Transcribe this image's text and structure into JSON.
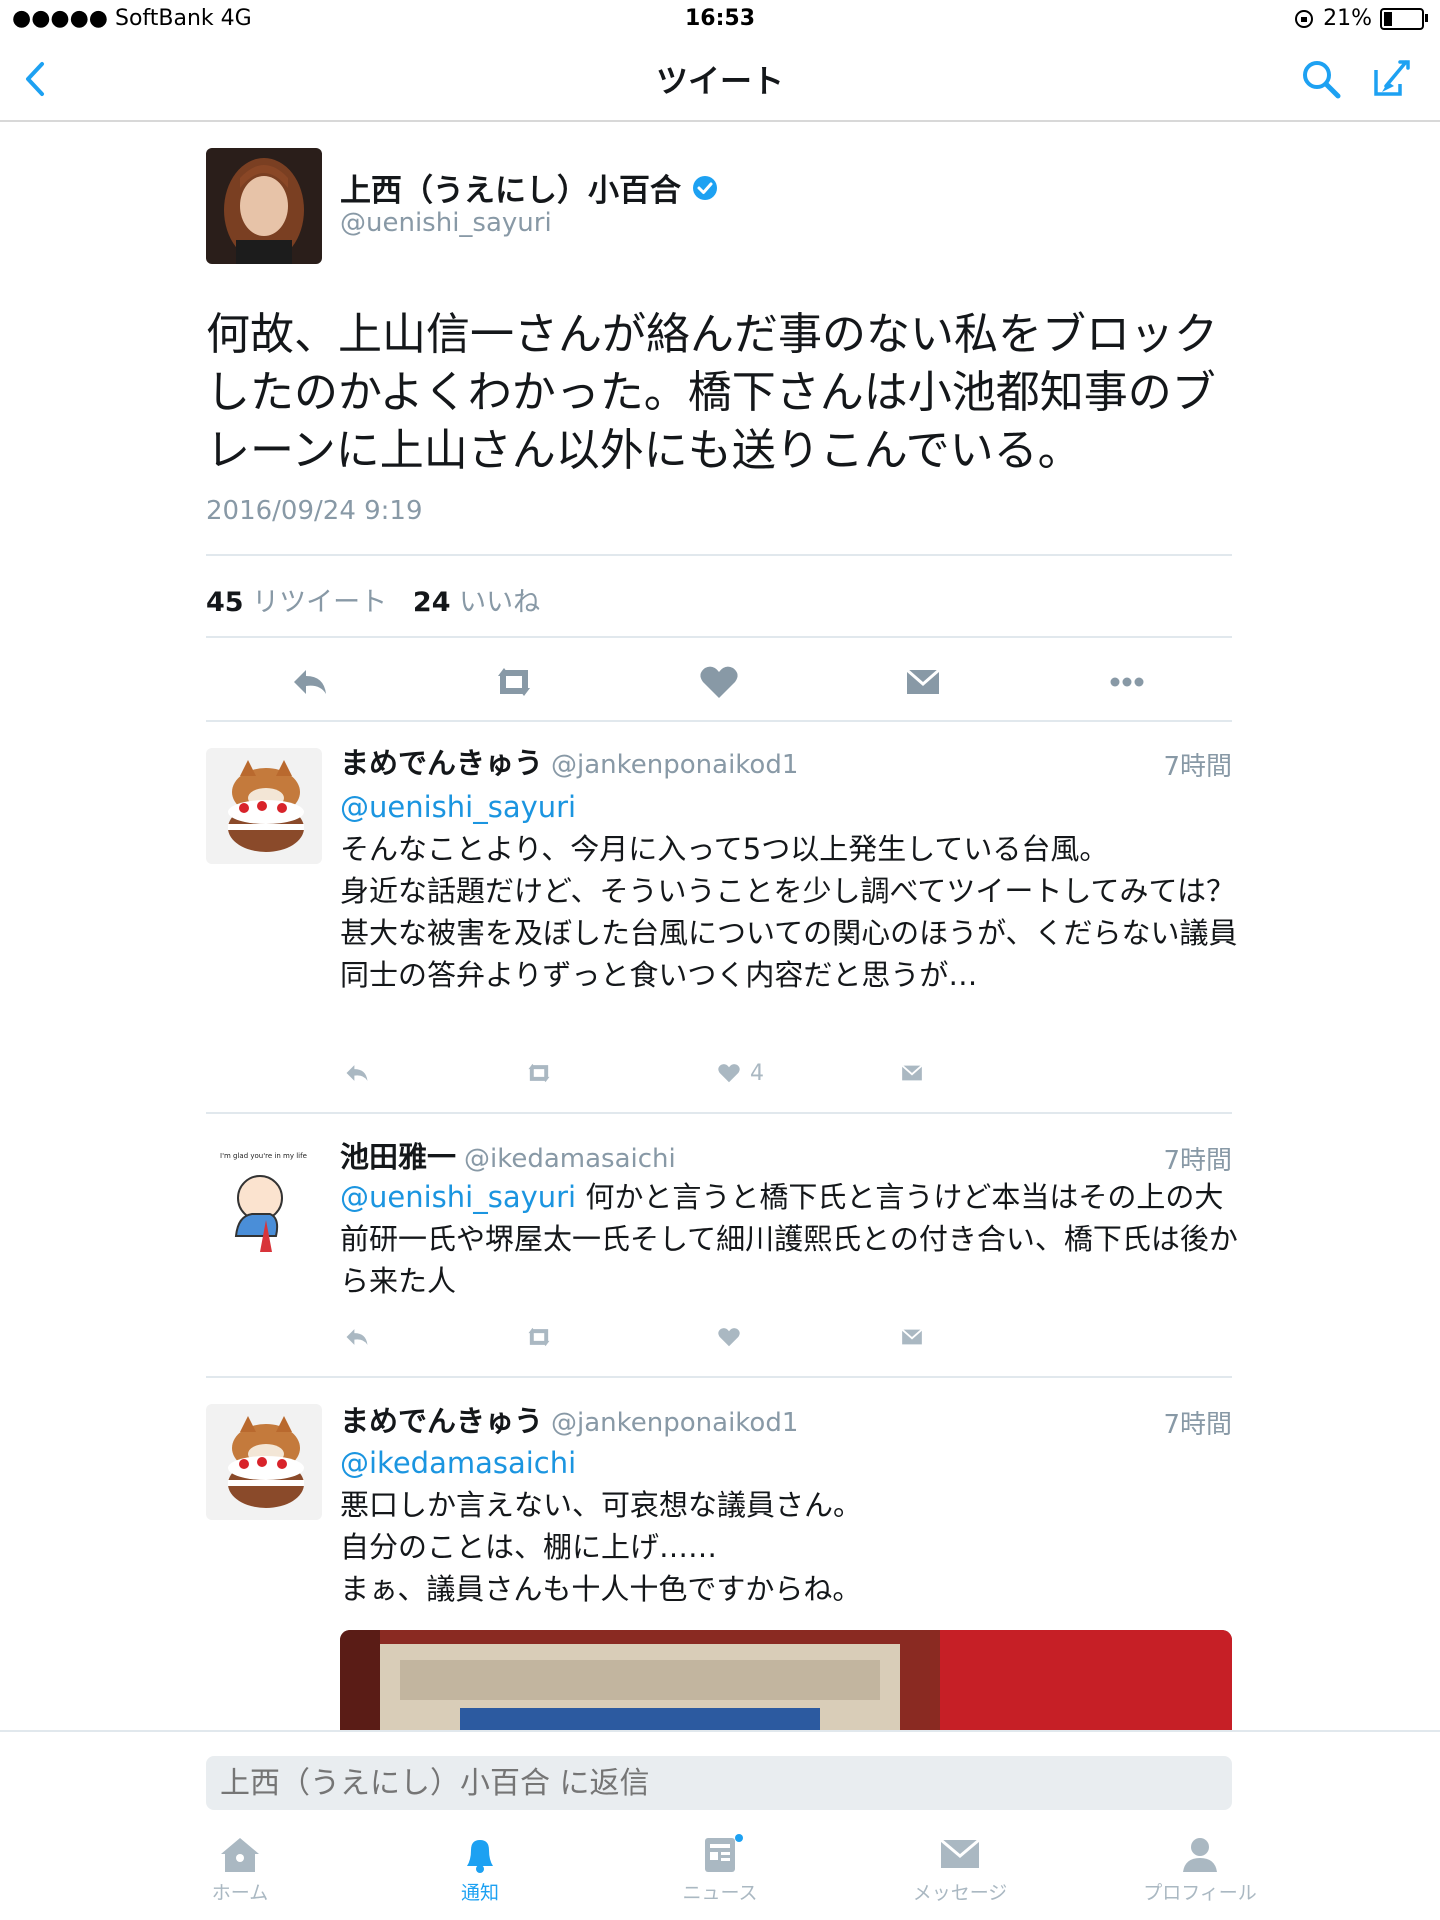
{
  "status_bar": {
    "carrier": "●●●●● SoftBank  4G",
    "time": "16:53",
    "battery": "21%",
    "battery_level": 0.21
  },
  "nav": {
    "title": "ツイート",
    "back_icon": "chevron-left-icon",
    "search_icon": "search-icon",
    "compose_icon": "compose-icon"
  },
  "colors": {
    "accent": "#1da1f2",
    "mention": "#1b95e0",
    "muted": "#8899a6",
    "icon": "#8899a6"
  },
  "main_tweet": {
    "name": "上西（うえにし）小百合",
    "handle": "@uenishi_sayuri",
    "text": "何故、上山信一さんが絡んだ事のない私をブロックしたのかよくわかった。橋下さんは小池都知事のブレーンに上山さん以外にも送りこんでいる。",
    "timestamp": "2016/09/24 9:19",
    "retweet_count": "45",
    "retweet_label": "リツイート",
    "like_count": "24",
    "like_label": "いいね"
  },
  "replies": [
    {
      "name": "まめでんきゅう",
      "handle": "@jankenponaikod1",
      "time": "7時間",
      "mention": "@uenishi_sayuri",
      "lines": [
        "そんなことより、今月に入って5つ以上発生している台風。",
        "身近な話題だけど、そういうことを少し調べてツイートしてみては？",
        "甚大な被害を及ぼした台風についての関心のほうが、くだらない議員同士の答弁よりずっと食いつく内容だと思うが…"
      ],
      "like_count": "4"
    },
    {
      "name": "池田雅一",
      "handle": "@ikedamasaichi",
      "time": "7時間",
      "mention": "@uenishi_sayuri",
      "text": "何かと言うと橋下氏と言うけど本当はその上の大前研一氏や堺屋太一氏そして細川護熙氏との付き合い、橋下氏は後から来た人",
      "avatar_caption": "I'm glad you're in my life"
    },
    {
      "name": "まめでんきゅう",
      "handle": "@jankenponaikod1",
      "time": "7時間",
      "mention": "@ikedamasaichi",
      "lines": [
        "悪口しか言えない、可哀想な議員さん。",
        "自分のことは、棚に上げ……",
        "まぁ、議員さんも十人十色ですからね。"
      ]
    }
  ],
  "reply_input": {
    "placeholder": "上西（うえにし）小百合 に返信"
  },
  "tabs": [
    {
      "label": "ホーム",
      "icon": "home-icon"
    },
    {
      "label": "通知",
      "icon": "bell-icon",
      "active": true
    },
    {
      "label": "ニュース",
      "icon": "news-icon",
      "badge": true
    },
    {
      "label": "メッセージ",
      "icon": "envelope-icon"
    },
    {
      "label": "プロフィール",
      "icon": "person-icon"
    }
  ]
}
